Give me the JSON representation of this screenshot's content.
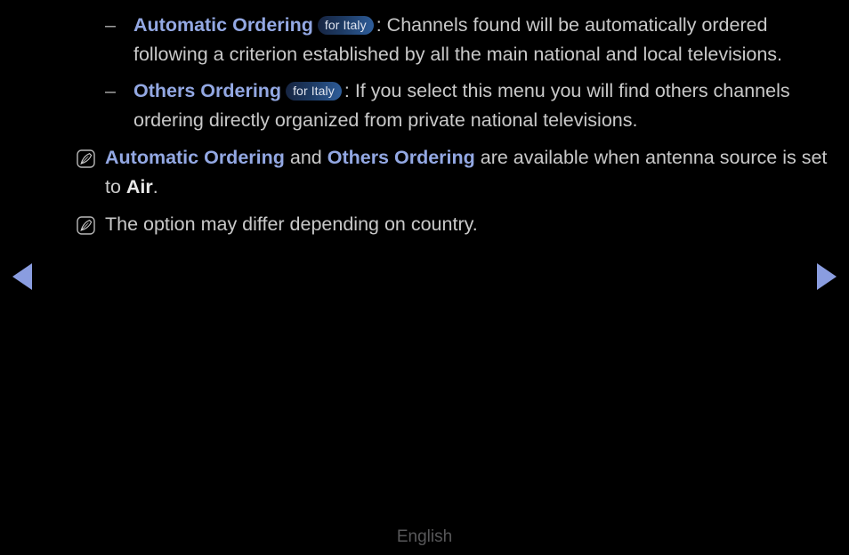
{
  "page": {
    "background_color": "#000000",
    "text_color": "#c9c9c9",
    "keyword_color": "#93a8e3",
    "arrow_color": "#8a9de0",
    "badge_text_color": "#dfe4ef",
    "badge_gradient_from": "#16233f",
    "badge_gradient_to": "#2f5f9d",
    "footer_color": "#58585a"
  },
  "bullets": [
    {
      "marker": "–",
      "keyword": "Automatic Ordering",
      "badge": "for Italy",
      "separator": ":",
      "text": " Channels found will be automatically ordered following a criterion established by all the main national and local televisions."
    },
    {
      "marker": "–",
      "keyword": "Others Ordering",
      "badge": "for Italy",
      "separator": ":",
      "text": " If you select this menu you will find others channels ordering directly organized from private national televisions."
    }
  ],
  "notes": [
    {
      "icon": "note-pencil-icon",
      "keyword1": "Automatic Ordering",
      "mid_text": " and ",
      "keyword2": "Others Ordering",
      "tail_text": " are available when antenna source is set to ",
      "keyword3": "Air",
      "end_text": "."
    },
    {
      "icon": "note-pencil-icon",
      "text": "The option may differ depending on country."
    }
  ],
  "navigation": {
    "prev_label": "◀",
    "next_label": "▶"
  },
  "footer": {
    "language": "English"
  }
}
